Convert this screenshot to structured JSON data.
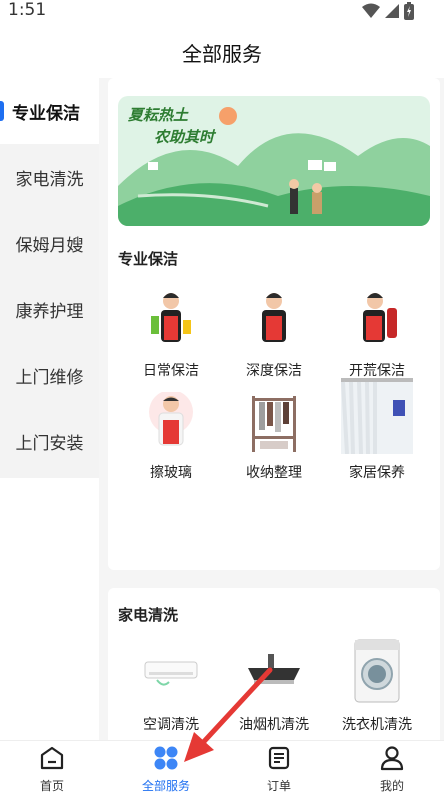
{
  "status": {
    "time": "1:51"
  },
  "header": {
    "title": "全部服务"
  },
  "sidebar": {
    "items": [
      {
        "label": "专业保洁",
        "active": true
      },
      {
        "label": "家电清洗"
      },
      {
        "label": "保姆月嫂"
      },
      {
        "label": "康养护理"
      },
      {
        "label": "上门维修"
      },
      {
        "label": "上门安装"
      }
    ]
  },
  "banner": {
    "line1": "夏耘热土",
    "line2": "农助其时"
  },
  "sections": [
    {
      "title": "专业保洁",
      "services": [
        {
          "label": "日常保洁",
          "icon": "cleaner-woman-icon"
        },
        {
          "label": "深度保洁",
          "icon": "cleaner-woman-icon"
        },
        {
          "label": "开荒保洁",
          "icon": "cleaner-woman-icon"
        },
        {
          "label": "擦玻璃",
          "icon": "cleaner-man-icon"
        },
        {
          "label": "收纳整理",
          "icon": "clothes-rack-icon"
        },
        {
          "label": "家居保养",
          "icon": "curtain-icon"
        }
      ]
    },
    {
      "title": "家电清洗",
      "services": [
        {
          "label": "空调清洗",
          "icon": "air-conditioner-icon"
        },
        {
          "label": "油烟机清洗",
          "icon": "range-hood-icon"
        },
        {
          "label": "洗衣机清洗",
          "icon": "washing-machine-icon"
        }
      ]
    }
  ],
  "tabbar": {
    "tabs": [
      {
        "label": "首页",
        "icon": "home-icon"
      },
      {
        "label": "全部服务",
        "icon": "services-grid-icon",
        "active": true
      },
      {
        "label": "订单",
        "icon": "order-icon"
      },
      {
        "label": "我的",
        "icon": "user-icon"
      }
    ]
  },
  "colors": {
    "accent": "#1e6ff1",
    "sidebar_bg": "#f3f3f3",
    "content_bg": "#f5f5f5",
    "arrow": "#e53935"
  }
}
